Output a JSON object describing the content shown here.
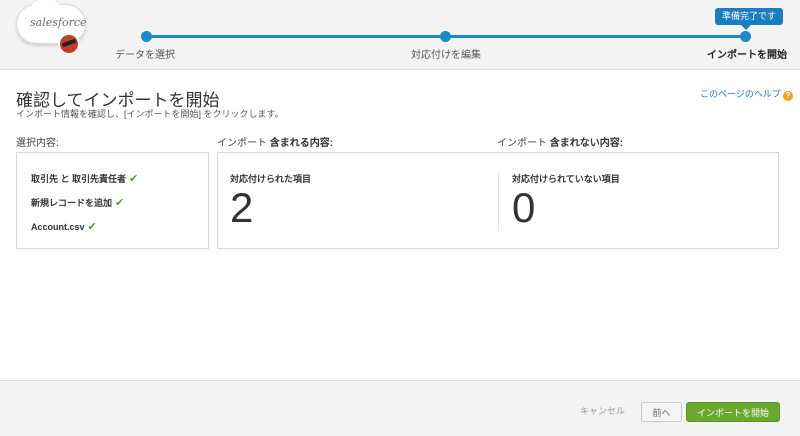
{
  "brand": {
    "logo_text": "salesforce"
  },
  "progress": {
    "steps": [
      {
        "label": "データを選択"
      },
      {
        "label": "対応付けを編集"
      },
      {
        "label": "インポートを開始"
      }
    ],
    "status_tip": "準備完了です",
    "current_step": 3
  },
  "page": {
    "title": "確認してインポートを開始",
    "subtitle": "インポート情報を確認し、[インポートを開始] をクリックします。",
    "help_link": "このページのヘルプ",
    "help_icon": "?"
  },
  "columns": {
    "selection_heading": "選択内容:",
    "included_prefix": "インポート",
    "included_suffix": "含まれる内容:",
    "excluded_prefix": "インポート",
    "excluded_suffix": "含まれない内容:"
  },
  "selection": {
    "items": [
      {
        "label": "取引先 と 取引先責任者"
      },
      {
        "label": "新規レコードを追加"
      },
      {
        "label": "Account.csv"
      }
    ],
    "check_glyph": "✔"
  },
  "counts": {
    "mapped_label": "対応付けられた項目",
    "mapped_value": "2",
    "unmapped_label": "対応付けられていない項目",
    "unmapped_value": "0"
  },
  "footer": {
    "cancel_label": "キャンセル",
    "prev_label": "前へ",
    "start_label": "インポートを開始"
  },
  "colors": {
    "progress": "#1a8bc7",
    "primary_button": "#6aa82f",
    "check": "#5aa02c",
    "help_icon": "#f0a01c"
  }
}
